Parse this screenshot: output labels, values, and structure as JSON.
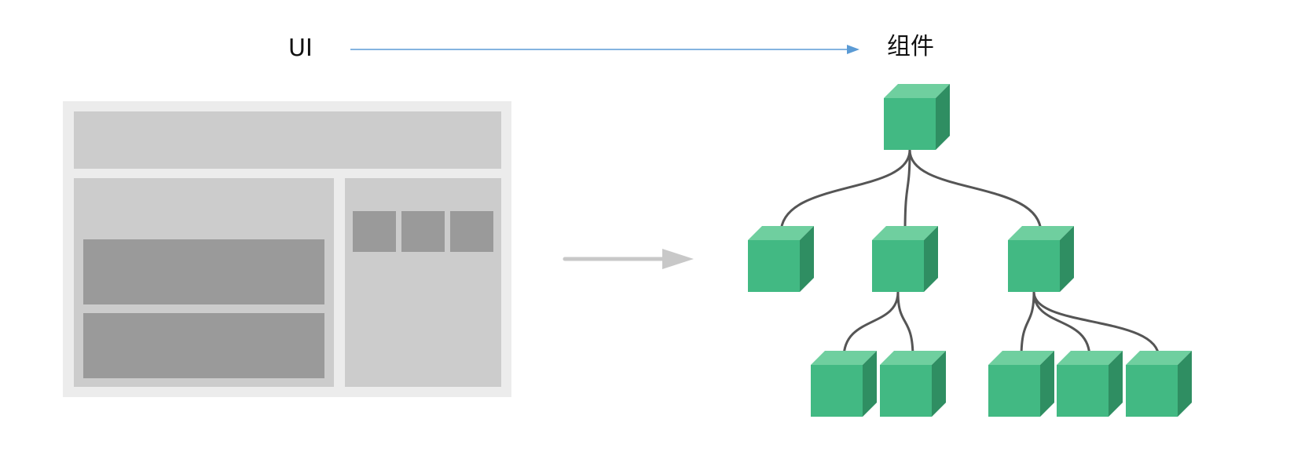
{
  "labels": {
    "source": "UI",
    "target": "组件"
  },
  "colors": {
    "top_arrow": "#5b9bd5",
    "mid_arrow": "#c8c8c8",
    "wireframe_frame": "#ececec",
    "wireframe_light": "#cccccc",
    "wireframe_dark": "#9a9a9a",
    "cube_front": "#42b983",
    "cube_top": "#6fcf9f",
    "cube_side": "#2f8e62",
    "connector": "#555555"
  },
  "icons": {
    "wireframe": "ui-layout-wireframe",
    "tree": "component-tree",
    "node": "component-cube"
  },
  "tree": {
    "root": "root",
    "children": {
      "root": [
        "n1",
        "n2",
        "n3"
      ],
      "n2": [
        "n4",
        "n5"
      ],
      "n3": [
        "n6",
        "n7",
        "n8"
      ]
    }
  }
}
